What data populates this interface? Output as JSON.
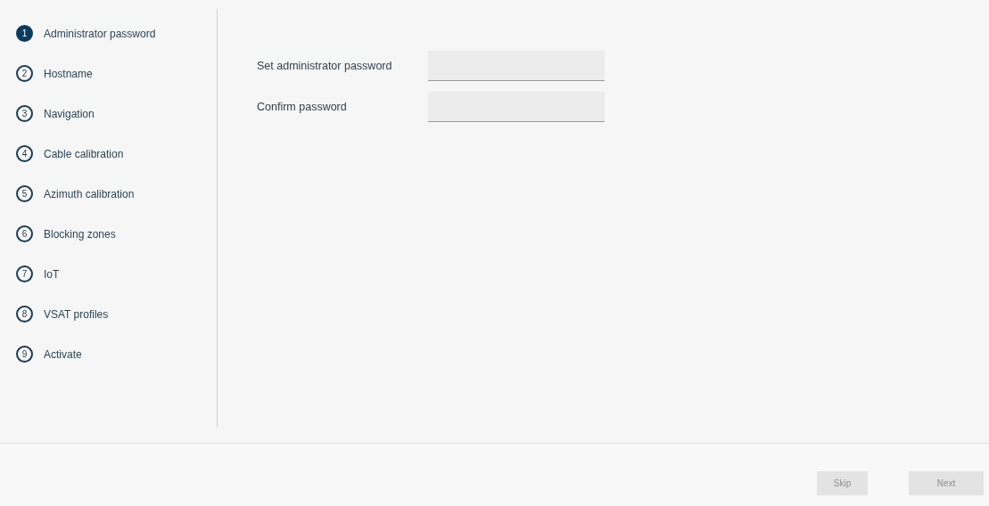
{
  "steps": [
    {
      "number": "1",
      "label": "Administrator password",
      "selected": true
    },
    {
      "number": "2",
      "label": "Hostname",
      "selected": false
    },
    {
      "number": "3",
      "label": "Navigation",
      "selected": false
    },
    {
      "number": "4",
      "label": "Cable calibration",
      "selected": false
    },
    {
      "number": "5",
      "label": "Azimuth calibration",
      "selected": false
    },
    {
      "number": "6",
      "label": "Blocking zones",
      "selected": false
    },
    {
      "number": "7",
      "label": "IoT",
      "selected": false
    },
    {
      "number": "8",
      "label": "VSAT profiles",
      "selected": false
    },
    {
      "number": "9",
      "label": "Activate",
      "selected": false
    }
  ],
  "form": {
    "fields": [
      {
        "label": "Set administrator password"
      },
      {
        "label": "Confirm password"
      }
    ]
  },
  "buttons": [
    {
      "label": "Skip",
      "disabled": true
    },
    {
      "label": "Next",
      "disabled": true
    }
  ]
}
